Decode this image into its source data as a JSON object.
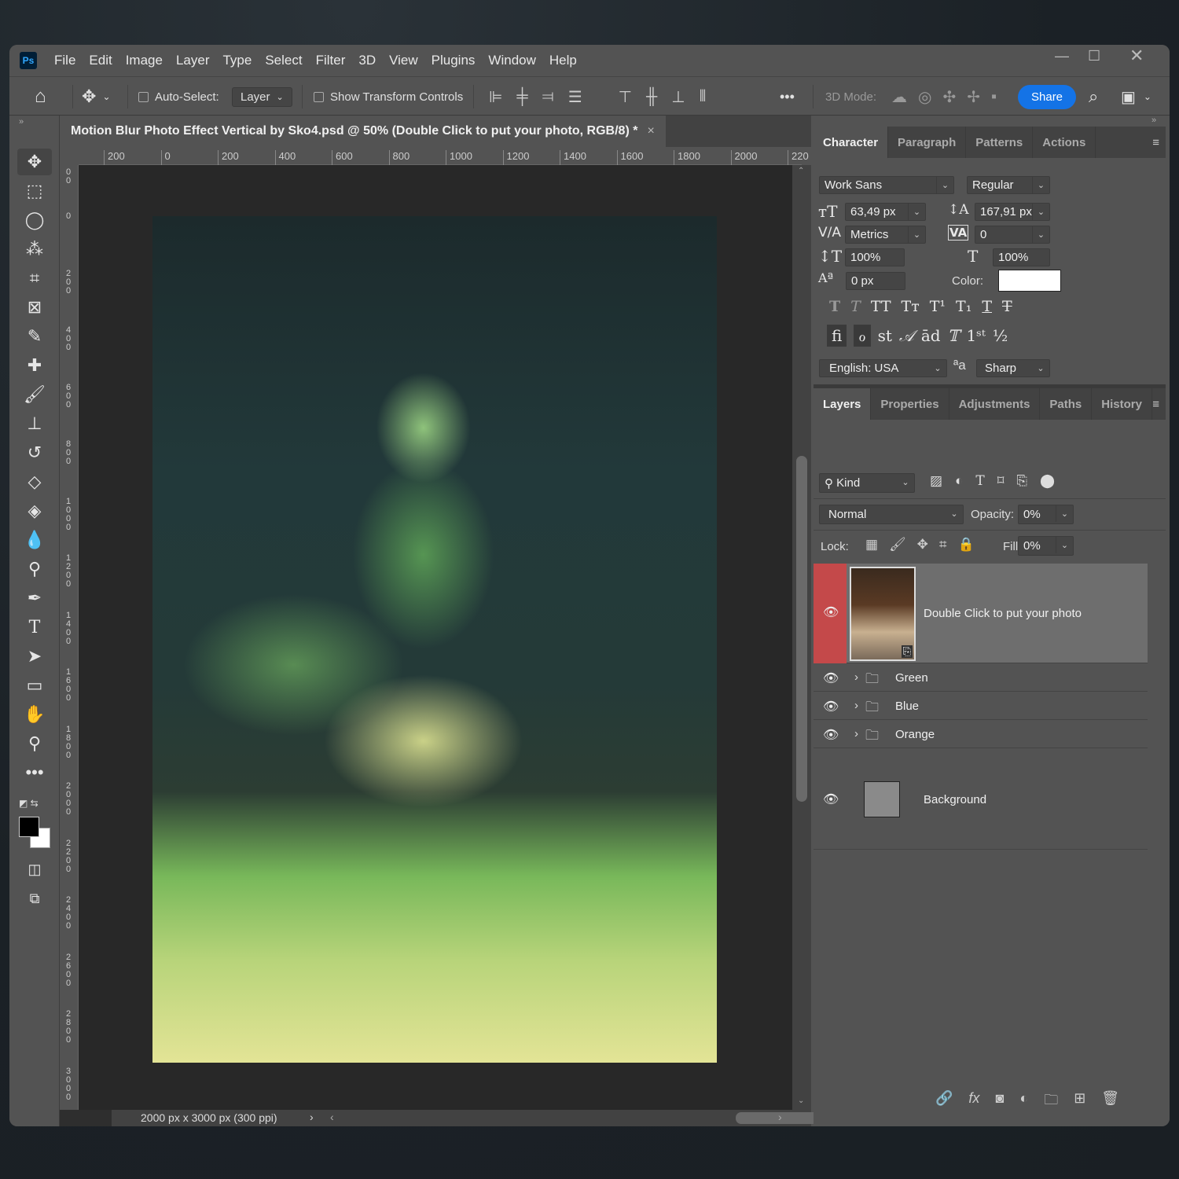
{
  "app": {
    "logo": "Ps",
    "menu": [
      "File",
      "Edit",
      "Image",
      "Layer",
      "Type",
      "Select",
      "Filter",
      "3D",
      "View",
      "Plugins",
      "Window",
      "Help"
    ],
    "window_controls": [
      "minimize-icon",
      "maximize-icon",
      "close-icon"
    ]
  },
  "options": {
    "auto_select_label": "Auto-Select:",
    "auto_select_checked": false,
    "layer_dropdown": "Layer",
    "show_transform_label": "Show Transform Controls",
    "show_transform_checked": false,
    "more": "•••",
    "mode_3d_label": "3D Mode:",
    "share_label": "Share",
    "accent": "#1473e6"
  },
  "document": {
    "tab_title": "Motion Blur Photo Effect Vertical by Sko4.psd @ 50% (Double Click to put your photo, RGB/8) *",
    "close": "×",
    "status": "2000 px x 3000 px (300 ppi)"
  },
  "rulers": {
    "horizontal": [
      "200",
      "0",
      "200",
      "400",
      "600",
      "800",
      "1000",
      "1200",
      "1400",
      "1600",
      "1800",
      "2000",
      "220"
    ],
    "vertical": [
      "00",
      "0",
      "200",
      "400",
      "600",
      "800",
      "1000",
      "1200",
      "1400",
      "1600",
      "1800",
      "2000",
      "2200",
      "2400",
      "2600",
      "2800",
      "3000"
    ]
  },
  "character": {
    "tabs": [
      "Character",
      "Paragraph",
      "Patterns",
      "Actions"
    ],
    "font_family": "Work Sans",
    "font_style": "Regular",
    "font_size": "63,49 px",
    "leading": "167,91 px",
    "kerning": "Metrics",
    "tracking": "0",
    "vertical_scale": "100%",
    "horizontal_scale": "100%",
    "baseline_shift": "0 px",
    "color_label": "Color:",
    "color": "#ffffff",
    "style_glyphs": [
      "T",
      "T",
      "TT",
      "Tт",
      "T¹",
      "T₁",
      "T",
      "T"
    ],
    "opentype_glyphs": [
      "ﬁ",
      "ℴ",
      "st",
      "𝒜",
      "ād",
      "𝕋",
      "1ˢᵗ",
      "½"
    ],
    "language": "English: USA",
    "aa_icon": "ªa",
    "antialias": "Sharp"
  },
  "layers": {
    "tabs": [
      "Layers",
      "Properties",
      "Adjustments",
      "Paths",
      "History"
    ],
    "filter_kind": "Kind",
    "blend_mode": "Normal",
    "opacity_label": "Opacity:",
    "opacity": "0%",
    "lock_label": "Lock:",
    "fill_label": "Fill:",
    "fill": "0%",
    "items": [
      {
        "name": "Double Click to put your photo",
        "type": "smart-object",
        "visible": true,
        "selected": true
      },
      {
        "name": "Green",
        "type": "group",
        "visible": true
      },
      {
        "name": "Blue",
        "type": "group",
        "visible": true
      },
      {
        "name": "Orange",
        "type": "group",
        "visible": true
      },
      {
        "name": "Background",
        "type": "background",
        "visible": true
      }
    ],
    "selected_color": "#c4494a"
  }
}
